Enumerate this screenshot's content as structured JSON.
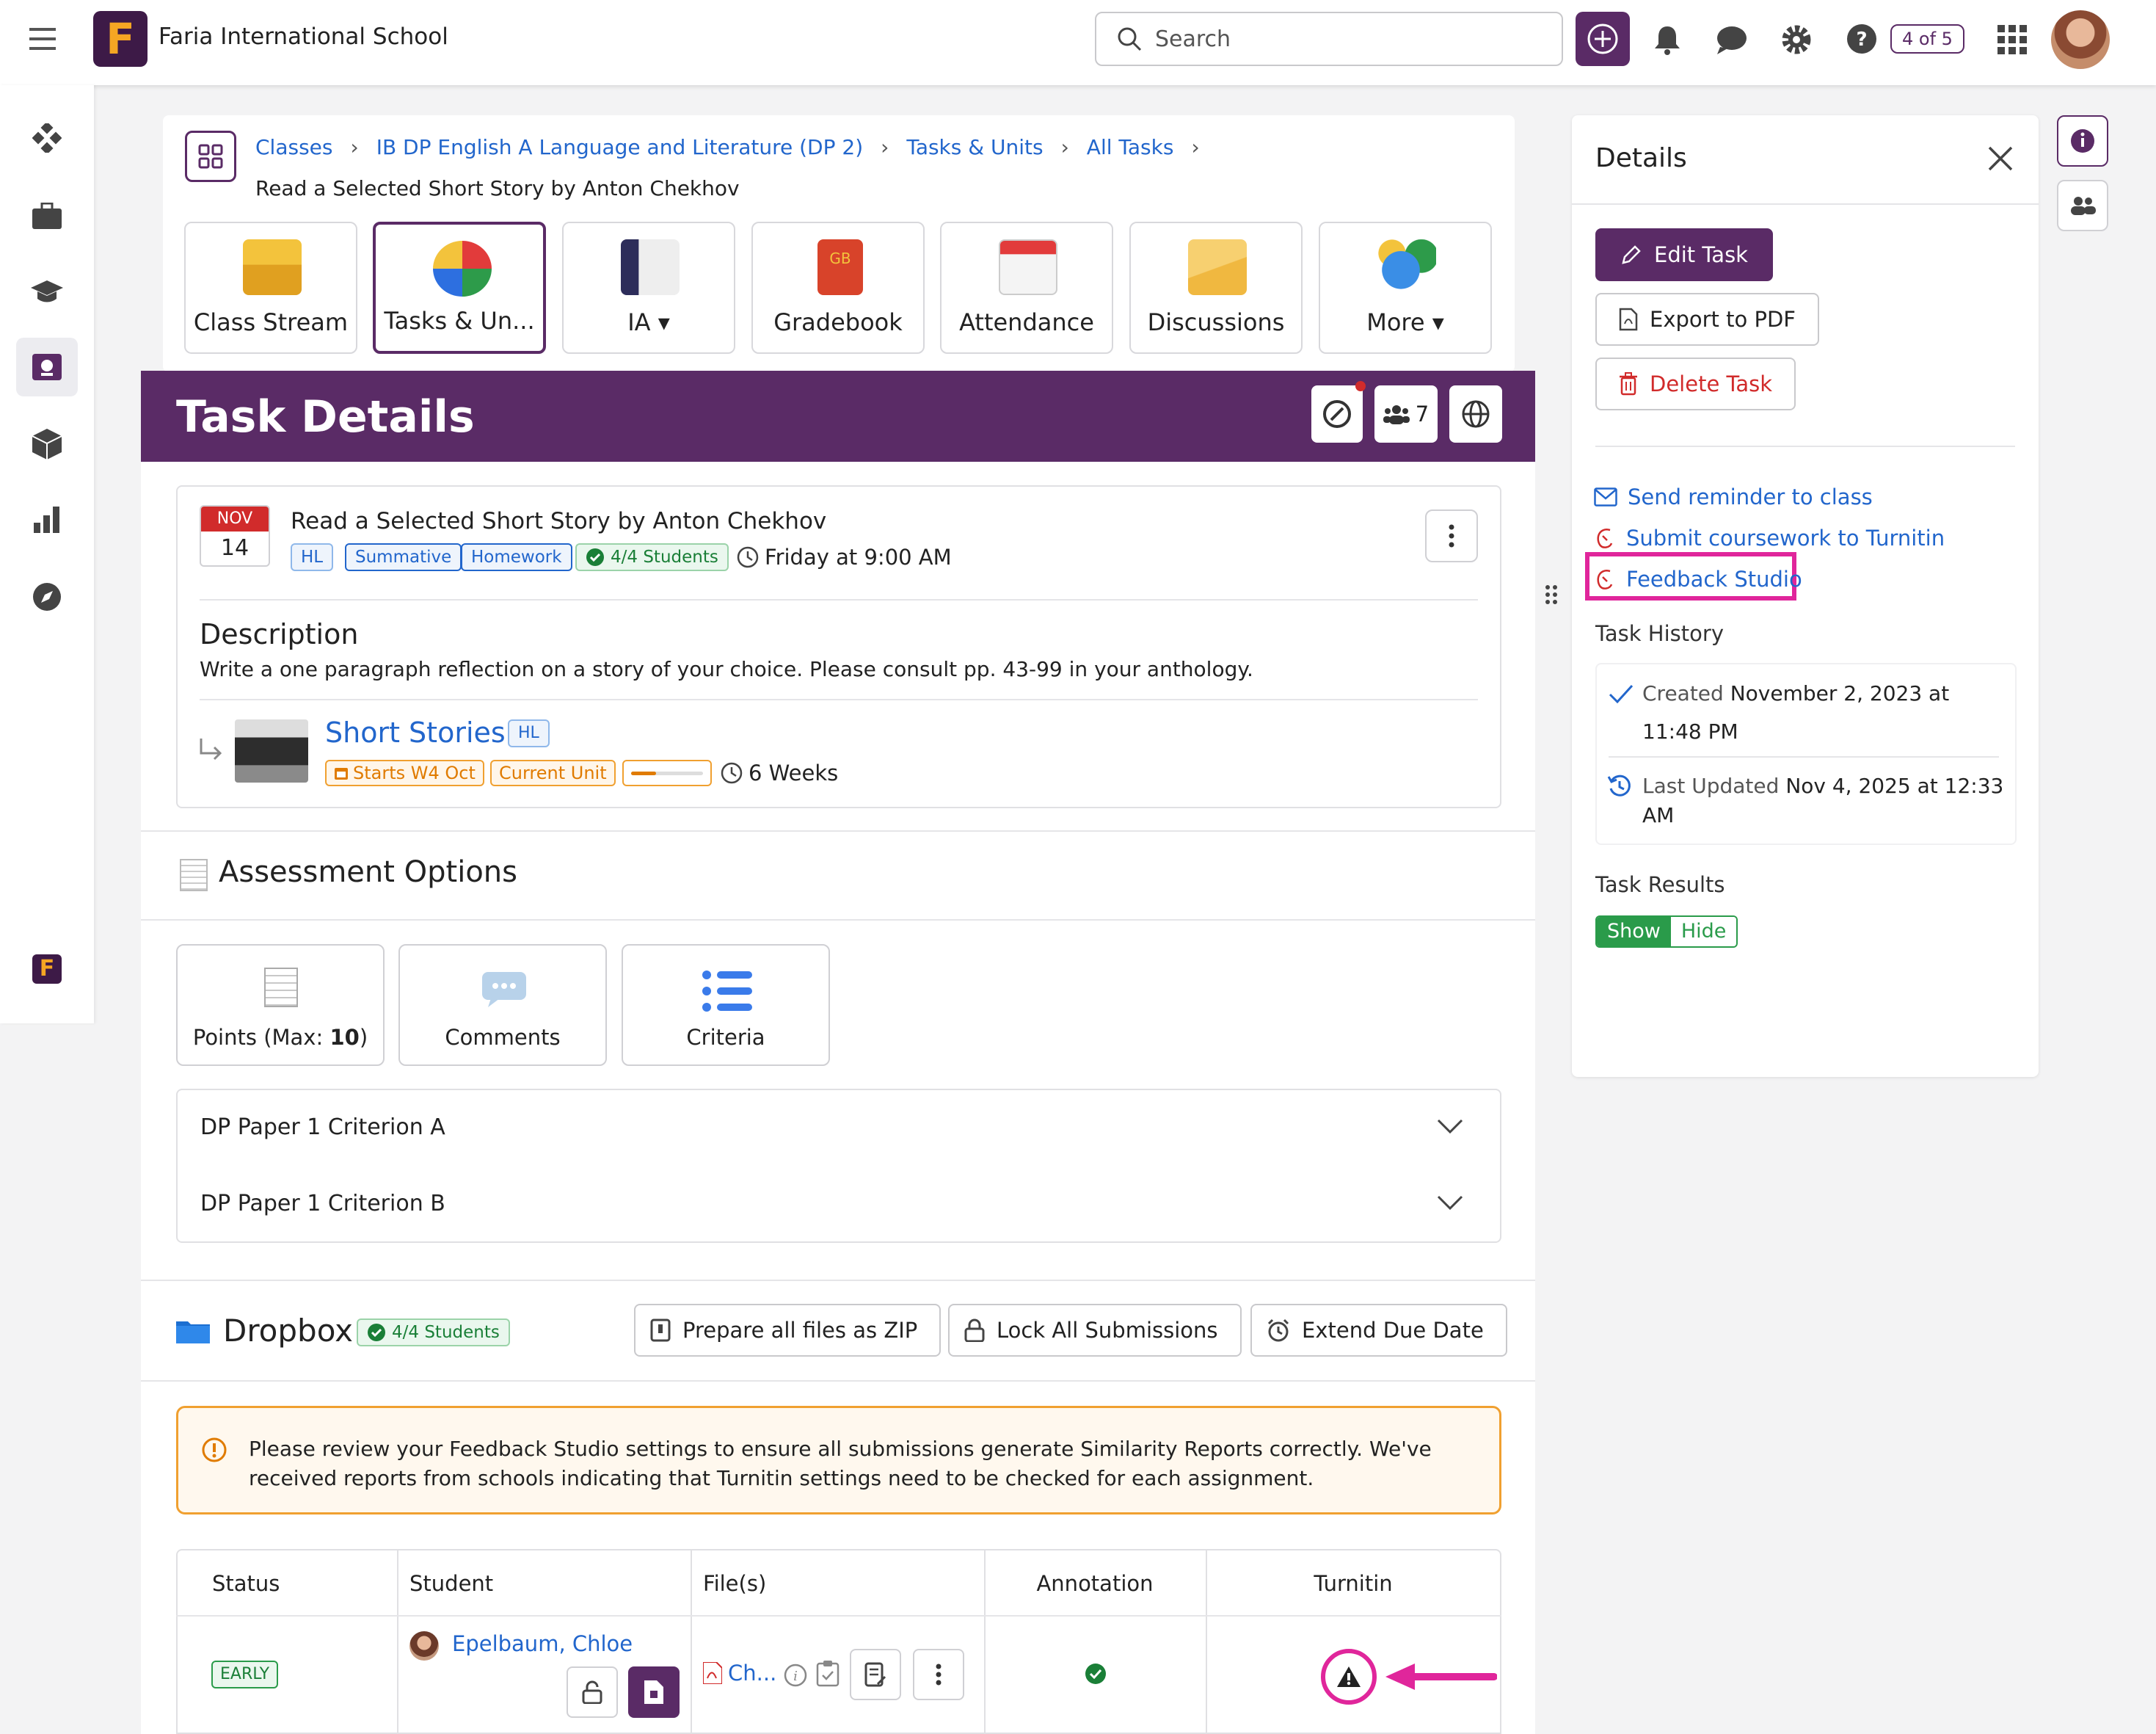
{
  "topbar": {
    "school": "Faria International School",
    "logo_letter": "F",
    "search_placeholder": "Search",
    "counter": "4 of 5"
  },
  "breadcrumb": {
    "items": [
      "Classes",
      "IB DP English A Language and Literature (DP 2)",
      "Tasks & Units",
      "All Tasks"
    ],
    "current": "Read a Selected Short Story by Anton Chekhov"
  },
  "tiles": [
    "Class Stream",
    "Tasks & Un...",
    "IA",
    "Gradebook",
    "Attendance",
    "Discussions",
    "More"
  ],
  "banner": {
    "title": "Task Details",
    "student_count": "7"
  },
  "task": {
    "month": "NOV",
    "day": "14",
    "title": "Read a Selected Short Story by Anton Chekhov",
    "tags": [
      "HL",
      "Summative",
      "Homework"
    ],
    "students": "4/4 Students",
    "due": "Friday at 9:00 AM",
    "description_heading": "Description",
    "description": "Write a one paragraph reflection on a story of your choice. Please consult pp. 43-99 in your anthology.",
    "unit": {
      "name": "Short Stories",
      "level": "HL",
      "starts": "Starts W4 Oct",
      "status": "Current Unit",
      "progress": 0.35,
      "duration": "6 Weeks"
    }
  },
  "assessment": {
    "heading": "Assessment Options",
    "points_prefix": "Points (Max: ",
    "points_max": "10",
    "points_suffix": ")",
    "comments": "Comments",
    "criteria": "Criteria",
    "criteria_items": [
      "DP Paper 1 Criterion A",
      "DP Paper 1 Criterion B"
    ]
  },
  "dropbox": {
    "heading": "Dropbox",
    "students": "4/4 Students",
    "buttons": [
      "Prepare all files as ZIP",
      "Lock All Submissions",
      "Extend Due Date"
    ],
    "alert": "Please review your Feedback Studio settings to ensure all submissions generate Similarity Reports correctly. We've received reports from schools indicating that Turnitin settings need to be checked for each assignment.",
    "columns": [
      "Status",
      "Student",
      "File(s)",
      "Annotation",
      "Turnitin"
    ],
    "rows": [
      {
        "status": "EARLY",
        "student": "Epelbaum, Chloe",
        "file": "Ch..."
      }
    ]
  },
  "details": {
    "heading": "Details",
    "edit": "Edit Task",
    "export": "Export to PDF",
    "delete": "Delete Task",
    "links": [
      "Send reminder to class",
      "Submit coursework to Turnitin",
      "Feedback Studio"
    ],
    "history_heading": "Task History",
    "created_label": "Created",
    "created_value": "November 2, 2023 at",
    "created_time": "11:48 PM",
    "updated_label": "Last Updated",
    "updated_value": "Nov 4, 2025 at 12:33",
    "updated_time": "AM",
    "results_heading": "Task Results",
    "show": "Show",
    "hide": "Hide"
  },
  "colors": {
    "brand": "#5a2b66",
    "link": "#2266cc",
    "highlight": "#e0269b",
    "warning": "#f0a030",
    "success": "#1a7f37",
    "danger": "#d12b2b"
  }
}
